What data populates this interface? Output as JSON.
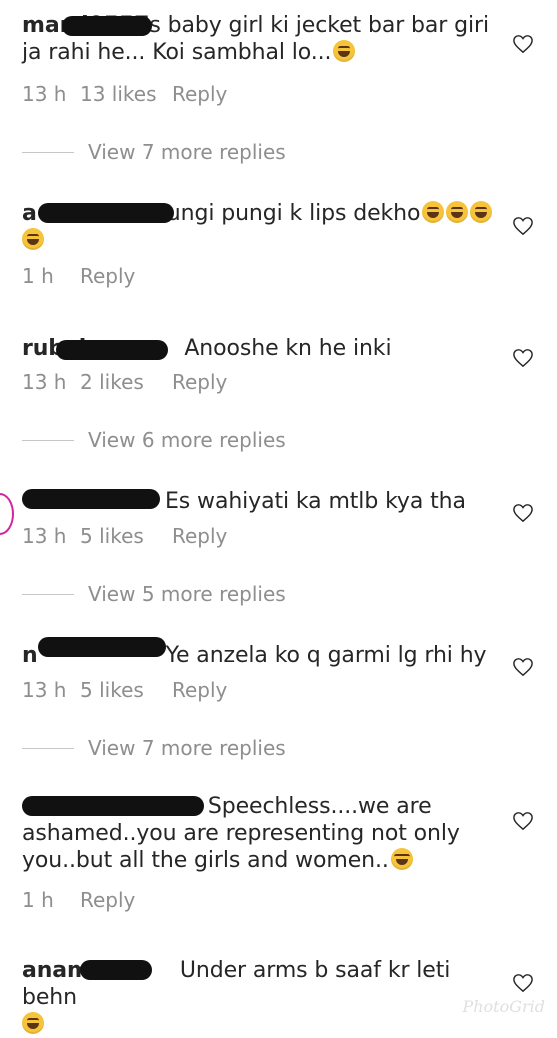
{
  "comments": [
    {
      "username": "marri0557",
      "text": "s baby girl ki jecket bar bar giri ja rahi he... Koi sambhal lo...",
      "emoji": [
        "grin-sweat"
      ],
      "time": "13 h",
      "likes": "13 likes",
      "reply": "Reply",
      "view_more": "View 7 more replies"
    },
    {
      "username": "a",
      "text": "lungi pungi k lips dekho",
      "emoji": [
        "grin-sweat",
        "grin-sweat",
        "grin-sweat",
        "grin-sweat"
      ],
      "time": "1 h",
      "likes": "",
      "reply": "Reply",
      "view_more": ""
    },
    {
      "username": "rubab",
      "text": "Anooshe kn he inki",
      "emoji": [],
      "time": "13 h",
      "likes": "2 likes",
      "reply": "Reply",
      "view_more": "View 6 more replies"
    },
    {
      "username": "",
      "text": "Es wahiyati ka mtlb kya tha",
      "emoji": [],
      "time": "13 h",
      "likes": "5 likes",
      "reply": "Reply",
      "view_more": "View 5 more replies"
    },
    {
      "username": "n",
      "text": "Ye anzela ko q garmi lg rhi hy",
      "emoji": [],
      "time": "13 h",
      "likes": "5 likes",
      "reply": "Reply",
      "view_more": "View 7 more replies"
    },
    {
      "username": "",
      "text": "r Speechless....we are ashamed..you are representing not only you..but all the girls and women..",
      "emoji": [
        "crying"
      ],
      "time": "1 h",
      "likes": "",
      "reply": "Reply",
      "view_more": ""
    },
    {
      "username": "anam",
      "text": "Under arms b saaf kr leti behn",
      "emoji": [
        "grin-sweat"
      ],
      "time": "",
      "likes": "",
      "reply": "",
      "view_more": ""
    }
  ],
  "icons": {
    "like": "heart-outline-icon",
    "emoji_laugh": "grin-sweat-emoji",
    "emoji_cry": "crying-emoji"
  },
  "watermark": "PhotoGrid",
  "colors": {
    "text": "#262626",
    "meta": "#8e8e8e",
    "divider": "#c7c7c7",
    "redaction": "#111111"
  }
}
